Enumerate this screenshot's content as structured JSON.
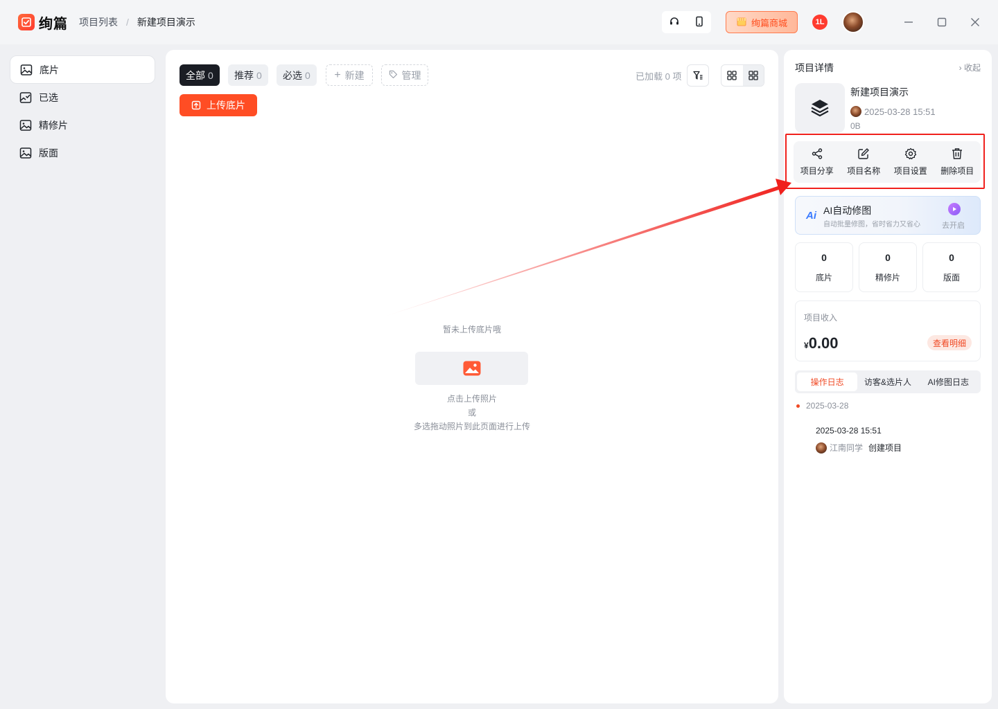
{
  "app": {
    "logo_text": "绚篇",
    "breadcrumb": [
      "项目列表",
      "新建项目演示"
    ],
    "mall_label": "绚篇商城",
    "notification_badge": "1L"
  },
  "sidebar": {
    "items": [
      {
        "label": "底片",
        "active": true
      },
      {
        "label": "已选",
        "active": false
      },
      {
        "label": "精修片",
        "active": false
      },
      {
        "label": "版面",
        "active": false
      }
    ]
  },
  "main": {
    "tabs": [
      {
        "label": "全部",
        "count": "0"
      },
      {
        "label": "推荐",
        "count": "0"
      },
      {
        "label": "必选",
        "count": "0"
      }
    ],
    "new_label": "新建",
    "manage_label": "管理",
    "loaded_text": "已加载 0 项",
    "upload_label": "上传底片",
    "empty_title": "暂未上传底片哦",
    "empty_hint": [
      "点击上传照片",
      "或",
      "多选拖动照片到此页面进行上传"
    ]
  },
  "details": {
    "title": "项目详情",
    "collapse_label": "收起",
    "project_name": "新建项目演示",
    "created_at": "2025-03-28 15:51",
    "size": "0B",
    "actions": [
      {
        "label": "项目分享",
        "icon": "share-icon"
      },
      {
        "label": "项目名称",
        "icon": "edit-icon"
      },
      {
        "label": "项目设置",
        "icon": "gear-icon"
      },
      {
        "label": "删除项目",
        "icon": "trash-icon"
      }
    ],
    "ai": {
      "logo": "Ai",
      "title": "AI自动修图",
      "subtitle": "自动批量修图，省时省力又省心",
      "cta": "去开启"
    },
    "stats": [
      {
        "value": "0",
        "label": "底片"
      },
      {
        "value": "0",
        "label": "精修片"
      },
      {
        "value": "0",
        "label": "版面"
      }
    ],
    "income": {
      "label": "项目收入",
      "currency": "¥",
      "amount": "0.00",
      "detail_label": "查看明细"
    },
    "log_tabs": [
      "操作日志",
      "访客&选片人",
      "AI修图日志"
    ],
    "log": {
      "date": "2025-03-28",
      "time": "2025-03-28 15:51",
      "user": "江南同学",
      "action": "创建项目"
    }
  },
  "colors": {
    "accent": "#ff4d24",
    "highlight_box": "#f0201c"
  }
}
